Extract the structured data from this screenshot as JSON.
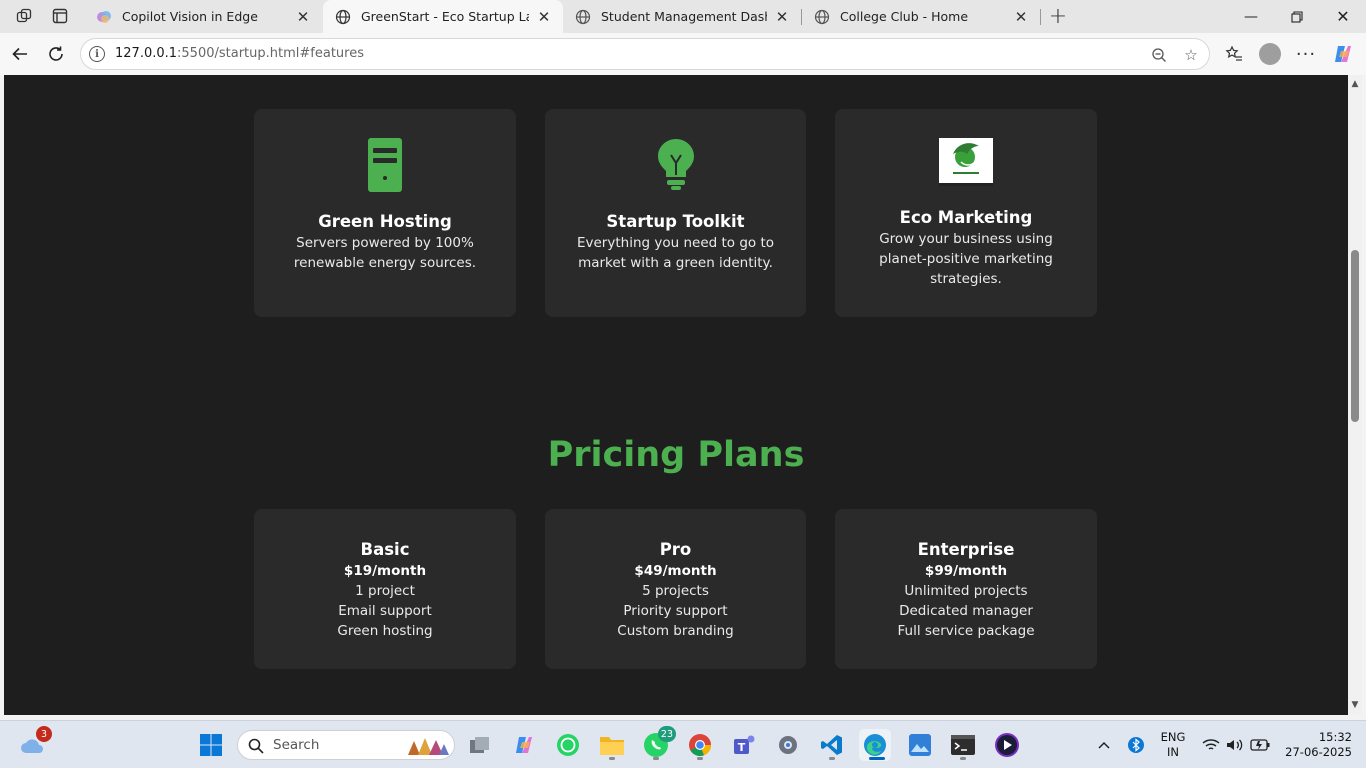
{
  "browser": {
    "tabs": [
      {
        "title": "Copilot Vision in Edge",
        "active": false
      },
      {
        "title": "GreenStart - Eco Startup Landing",
        "active": true
      },
      {
        "title": "Student Management Dashboard",
        "active": false
      },
      {
        "title": "College Club - Home",
        "active": false
      }
    ],
    "url_host": "127.0.0.1",
    "url_rest": ":5500/startup.html#features"
  },
  "features": [
    {
      "title": "Green Hosting",
      "desc": "Servers powered by 100% renewable energy sources.",
      "icon": "server-icon"
    },
    {
      "title": "Startup Toolkit",
      "desc": "Everything you need to go to market with a green identity.",
      "icon": "lightbulb-icon"
    },
    {
      "title": "Eco Marketing",
      "desc": "Grow your business using planet-positive marketing strategies.",
      "icon": "eco-logo-image"
    }
  ],
  "pricing": {
    "heading": "Pricing Plans",
    "plans": [
      {
        "name": "Basic",
        "price": "$19/month",
        "features": [
          "1 project",
          "Email support",
          "Green hosting"
        ]
      },
      {
        "name": "Pro",
        "price": "$49/month",
        "features": [
          "5 projects",
          "Priority support",
          "Custom branding"
        ]
      },
      {
        "name": "Enterprise",
        "price": "$99/month",
        "features": [
          "Unlimited projects",
          "Dedicated manager",
          "Full service package"
        ]
      }
    ]
  },
  "colors": {
    "accent": "#4caf50",
    "page_bg": "#1e1e1e",
    "card_bg": "#2a2a2a"
  },
  "taskbar": {
    "weather_badge": "3",
    "search_placeholder": "Search",
    "whatsapp_badge": "23",
    "language_top": "ENG",
    "language_bottom": "IN",
    "time": "15:32",
    "date": "27-06-2025"
  }
}
